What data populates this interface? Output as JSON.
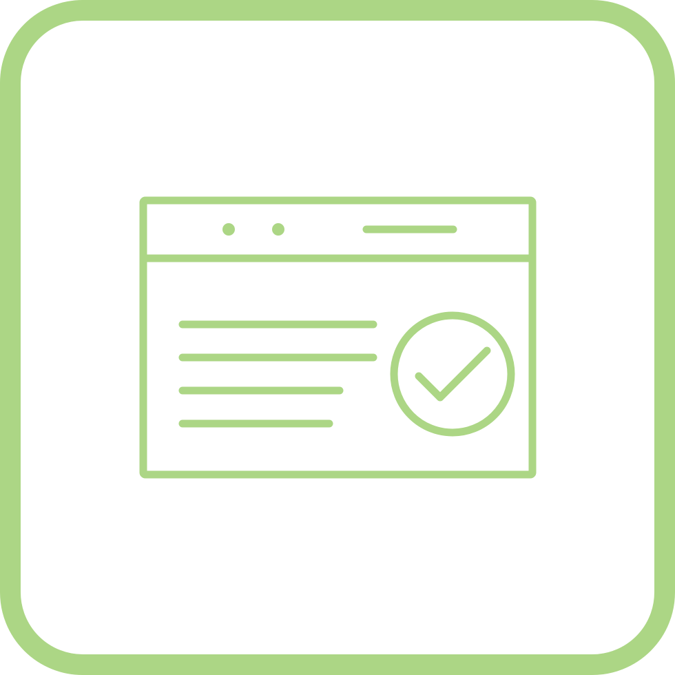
{
  "icon": {
    "name": "browser-window-verified",
    "elements": [
      "rounded-frame",
      "browser-window",
      "window-dots",
      "address-bar",
      "text-lines",
      "check-circle",
      "check-mark"
    ]
  },
  "colors": {
    "stroke": "#acd685",
    "background": "#ffffff"
  }
}
